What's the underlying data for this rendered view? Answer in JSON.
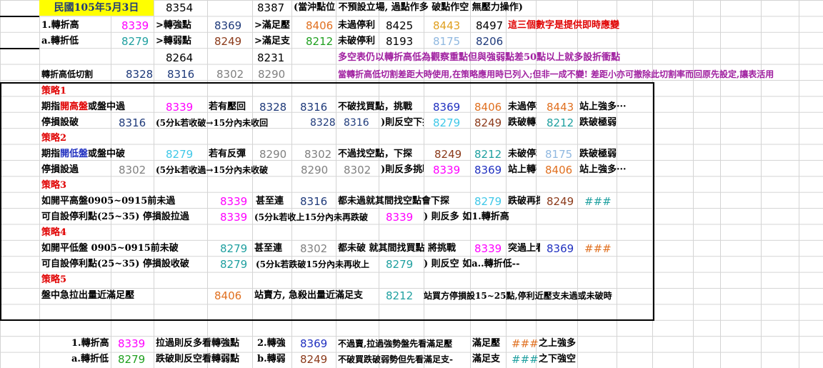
{
  "header": {
    "date": "民國105年5月3日",
    "v1": "8354",
    "v2": "8387",
    "note": "(當沖點位 不預設立場, 過點作多 破點作空 無壓力操作)"
  },
  "row_high": {
    "label": "1.轉折高",
    "val": "8339",
    "l2": ">轉強點",
    "v2": "8369",
    "l3": ">滿足壓",
    "v3": "8406",
    "l4": "未過停利",
    "v4": "8425",
    "v5": "8443",
    "v6": "8497",
    "note": "這三個數字是提供即時應變"
  },
  "row_low": {
    "label": "a.轉折低",
    "val": "8279",
    "l2": ">轉弱點",
    "v2": "8249",
    "l3": ">滿足支",
    "v3": "8212",
    "l4": "未破停利",
    "v4": "8193",
    "v5": "8175",
    "v6": "8206"
  },
  "row3": {
    "v1": "8264",
    "v2": "8231",
    "note": "多空表仍以轉折高低為觀察重點但與強弱點差50點以上就多設折衝點"
  },
  "row4": {
    "label": "轉折高低切割",
    "v1": "8328",
    "v2": "8316",
    "v3": "8302",
    "v4": "8290",
    "note": "當轉折高低切割差距大時使用,在策略應用時已列入;但非一成不變! 差距小亦可撤除此切割率而回原先設定,讓表活用"
  },
  "s1": {
    "title": "策略1",
    "a_pre": "期指",
    "a_em": "開高盤",
    "a_post": "或盤中過",
    "a_v1": "8339",
    "a_l2": "若有壓回",
    "a_v2": "8328",
    "a_v3": "8316",
    "a_l4": "不破找買點，挑戰",
    "a_v4": "8369",
    "a_v5": "8406",
    "a_l6": "未過停利",
    "a_v6": "8443",
    "a_l7": "站上強多···",
    "b_l1": "停損設破",
    "b_v1": "8316",
    "b_l2": "(5分k若收破→15分內未收回",
    "b_v2": "8328",
    "b_v3": "8316",
    "b_l4": ")則反空下探",
    "b_v4": "8279",
    "b_v5": "8249",
    "b_l6": "跌破轉弱",
    "b_v6": "8212",
    "b_l7": "跌破極弱"
  },
  "s2": {
    "title": "策略2",
    "a_pre": "期指",
    "a_em": "開低盤",
    "a_post": "或盤中破",
    "a_v1": "8279",
    "a_l2": "若有反彈",
    "a_v2": "8290",
    "a_v3": "8302",
    "a_l4": "不過找空點，下探",
    "a_v4": "8249",
    "a_v5": "8212",
    "a_l6": "未破停利",
    "a_v6": "8175",
    "a_l7": "跌破極弱",
    "b_l1": "停損設過",
    "b_v1": "8302",
    "b_l2": "(5分k若收過→15分內未收破",
    "b_v2": "8290",
    "b_v3": "8302",
    "b_l4": ")則反多挑戰",
    "b_v4": "8339",
    "b_v5": "8369",
    "b_l6": "站上轉強",
    "b_v6": "8406",
    "b_l7": "站上強多···"
  },
  "s3": {
    "title": "策略3",
    "a_l1": "如開平高盤0905~0915前未過",
    "a_v1": "8339",
    "a_l2": "甚至連",
    "a_v2": "8316",
    "a_l3": "都未過就其間找空點會下探",
    "a_v3": "8279",
    "a_l4": "跌破再探",
    "a_v4": "8249",
    "a_v5": "###",
    "b_l1": "可自設停利點(25~35) 停損設拉過",
    "b_v1": "8339",
    "b_l2": "(5分k若收上15分內未再跌破",
    "b_v2": "8339",
    "b_l3": ") 則反多 如1.轉折高"
  },
  "s4": {
    "title": "策略4",
    "a_l1": "如開平低盤 0905~0915前未破",
    "a_v1": "8279",
    "a_l2": "甚至連",
    "a_v2": "8302",
    "a_l3": "都未破 就其間找買點 將挑戰",
    "a_v3": "8339",
    "a_l4": "突過上看",
    "a_v4": "8369",
    "a_v5": "###",
    "b_l1": "可自設停利點(25~35) 停損設收破",
    "b_v1": "8279",
    "b_l2": "(5分k若跌破15分內未再收上",
    "b_v2": "8279",
    "b_l3": ") 則反空  如a..轉折低--"
  },
  "s5": {
    "title": "策略5",
    "l1": "盤中急拉出量近滿足壓",
    "v1": "8406",
    "l2": "站賣方,  急殺出量近滿足支",
    "v2": "8212",
    "l3": "站買方停損設15~25點,停利近壓支未過或未破時"
  },
  "foot1": {
    "label": "1.轉折高",
    "v1": "8339",
    "l2": "拉過則反多看轉強點",
    "l3": "2.轉強",
    "v2": "8369",
    "l4": "不過賣,拉過強勢盤先看滿足壓",
    "l5": "滿足壓",
    "v3": "###",
    "l6": "之上強多"
  },
  "foot2": {
    "label": "a.轉折低",
    "v1": "8279",
    "l2": "跌破則反空看轉弱點",
    "l3": "b.轉弱",
    "v2": "8249",
    "l4": "不破買跌破弱勢但先看滿足支-",
    "l5": "滿足支",
    "v3": "###",
    "l6": "之下強空"
  },
  "colors": {
    "magenta": "#ff00ff",
    "navy": "#1f3a7a",
    "brown": "#8b3a1a",
    "orange": "#e07020",
    "green": "#20a020",
    "teal": "#20a0a0",
    "gray": "#808080",
    "cyan": "#40c8e8",
    "lightblue": "#90b8e0",
    "blue": "#2030c0",
    "red": "#e00000",
    "purple": "#a020a0",
    "yellow": "#ffff00"
  }
}
